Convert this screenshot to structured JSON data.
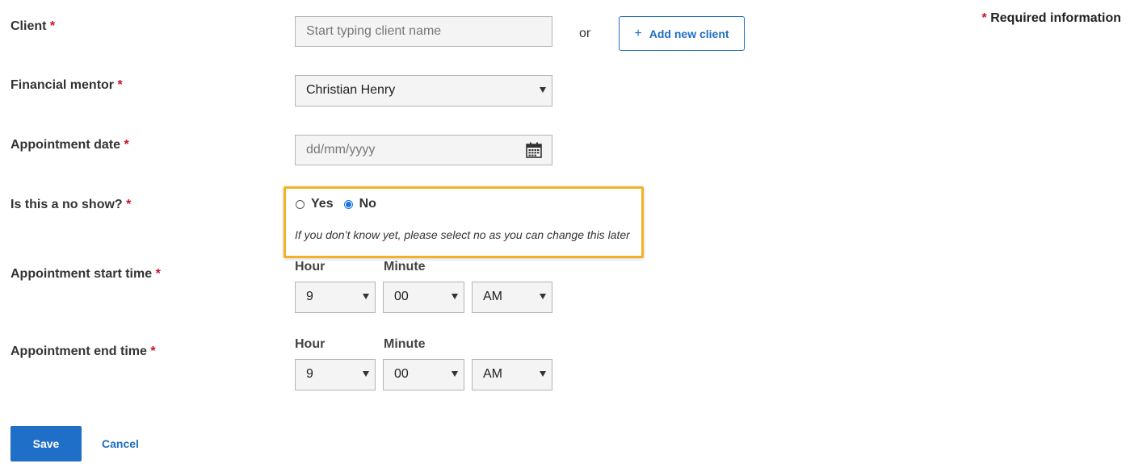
{
  "required_info": {
    "marker": "*",
    "text": "Required information"
  },
  "client": {
    "label": "Client",
    "required_marker": "*",
    "placeholder": "Start typing client name",
    "or_text": "or",
    "add_button_label": "Add new client",
    "add_button_icon": "plus-icon"
  },
  "financial_mentor": {
    "label": "Financial mentor",
    "required_marker": "*",
    "selected": "Christian Henry"
  },
  "appointment_date": {
    "label": "Appointment date",
    "required_marker": "*",
    "placeholder": "dd/mm/yyyy",
    "icon": "calendar-icon"
  },
  "no_show": {
    "label": "Is this a no show?",
    "required_marker": "*",
    "options": [
      "Yes",
      "No"
    ],
    "selected": "No",
    "hint": "If you don’t know yet, please select no as you can change this later",
    "highlight_color": "#f2b227"
  },
  "start_time": {
    "label": "Appointment start time",
    "required_marker": "*",
    "hour_label": "Hour",
    "minute_label": "Minute",
    "hour": "9",
    "minute": "00",
    "period": "AM"
  },
  "end_time": {
    "label": "Appointment end time",
    "required_marker": "*",
    "hour_label": "Hour",
    "minute_label": "Minute",
    "hour": "9",
    "minute": "00",
    "period": "AM"
  },
  "actions": {
    "save_label": "Save",
    "cancel_label": "Cancel"
  },
  "colors": {
    "primary": "#1f6fc9",
    "required": "#c8102e",
    "radio_checked": "#1a73e8"
  }
}
